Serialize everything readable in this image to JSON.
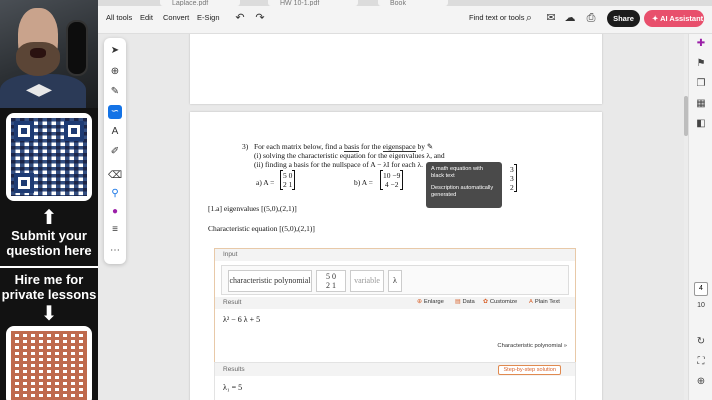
{
  "tabs": [
    "Laplace.pdf",
    "HW 10-1.pdf",
    "Book"
  ],
  "menu": {
    "all_tools": "All tools",
    "edit": "Edit",
    "convert": "Convert",
    "esign": "E-Sign",
    "find": "Find text or tools",
    "share": "Share",
    "ai_assistant": "AI Assistant"
  },
  "promo": {
    "submit": "Submit your question here",
    "hire": "Hire me for private lessons"
  },
  "document": {
    "problem_number": "3)",
    "line1_pre": "For each matrix below, find a",
    "line1_basis": "basis",
    "line1_mid": "for the",
    "line1_eigenspace": "eigenspace",
    "line1_post": "by",
    "line2": "(i) solving the characteristic equation for the eigenvalues λ, and",
    "line3": "(ii) finding a basis for the nullspace of A − λI for each λ.",
    "part_a_label": "a) A =",
    "part_a_matrix": [
      "5  0",
      "2  1"
    ],
    "part_b_label": "b) A =",
    "part_b_matrix": [
      "10  −9",
      "4   −2"
    ],
    "part_c_matrix": [
      "3",
      "3",
      "2"
    ],
    "note1": "[1.a] eigenvalues [(5,0),(2,1)]",
    "note2": "Characteristic equation [(5,0),(2,1)]"
  },
  "tooltip": {
    "line1": "A math equation with black text",
    "line2": "Description automatically generated"
  },
  "wolfram": {
    "input_label": "Input",
    "char_poly": "characteristic polynomial",
    "matrix": [
      "5  0",
      "2  1"
    ],
    "variable_label": "variable",
    "variable_value": "λ",
    "result_label": "Result",
    "actions": [
      "Enlarge",
      "Data",
      "Customize",
      "Plain Text"
    ],
    "result": "λ² − 6 λ + 5",
    "link": "Characteristic polynomial »",
    "results_label": "Results",
    "step_button": "Step-by-step solution",
    "lambda1": "λ₁ = 5"
  },
  "page_nav": {
    "current": "4",
    "total": "10"
  },
  "colors": {
    "accent": "#1473e6",
    "ai": "#e84f6c",
    "wolfram_orange": "#d9622b"
  }
}
